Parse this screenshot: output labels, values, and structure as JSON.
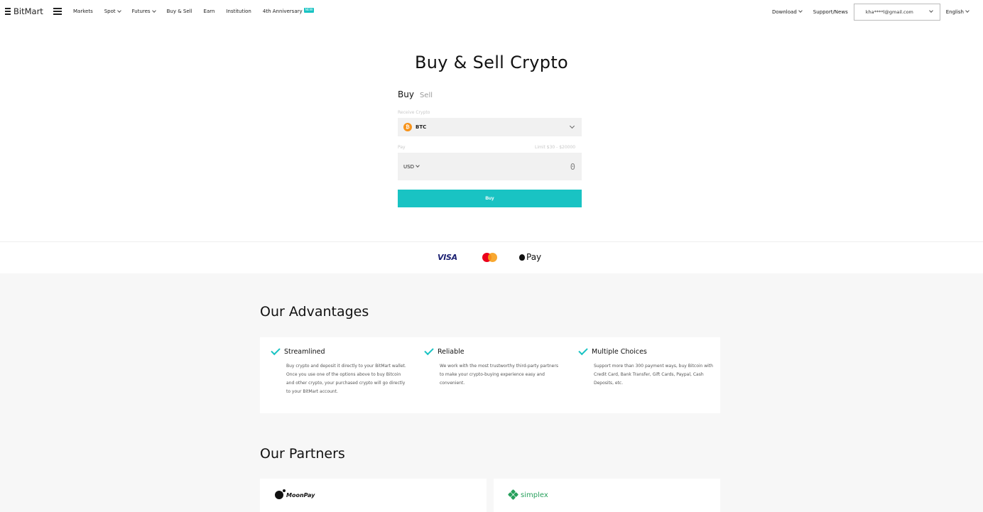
{
  "header": {
    "logo_text": "BitMart",
    "nav": [
      "Markets",
      "Spot",
      "Futures",
      "Buy & Sell",
      "Earn",
      "Institution",
      "4th Anniversary"
    ],
    "new_badge": "NEW",
    "download": "Download",
    "support": "Support/News",
    "email": "kha****l@gmail.com",
    "language": "English"
  },
  "hero": {
    "title": "Buy & Sell Crypto",
    "tab_buy": "Buy",
    "tab_sell": "Sell",
    "receive_label": "Receive Crypto",
    "receive_value": "BTC",
    "pay_label": "Pay",
    "limit": "Limit $30 - $20000",
    "pay_currency": "USD",
    "amount": "0",
    "buy_button": "Buy"
  },
  "payment_methods": [
    "VISA",
    "Pay"
  ],
  "advantages": {
    "title": "Our Advantages",
    "items": [
      {
        "title": "Streamlined",
        "text": "Buy crypto and deposit it directly to your BitMart wallet. Once you use one of the options above to buy Bitcoin and other crypto, your purchased crypto will go directly to your BitMart account."
      },
      {
        "title": "Reliable",
        "text": "We work with the most trustworthy third-party partners to make your crypto-buying experience easy and convenient."
      },
      {
        "title": "Multiple Choices",
        "text": "Support more than 300 payment ways, buy Bitcoin with Credit Card, Bank Transfer, Gift Cards, Paypal, Cash Deposits, etc."
      }
    ]
  },
  "partners": {
    "title": "Our Partners",
    "items": [
      "MoonPay",
      "simplex"
    ]
  },
  "colors": {
    "accent": "#19c3c3",
    "btc": "#f7931a"
  }
}
